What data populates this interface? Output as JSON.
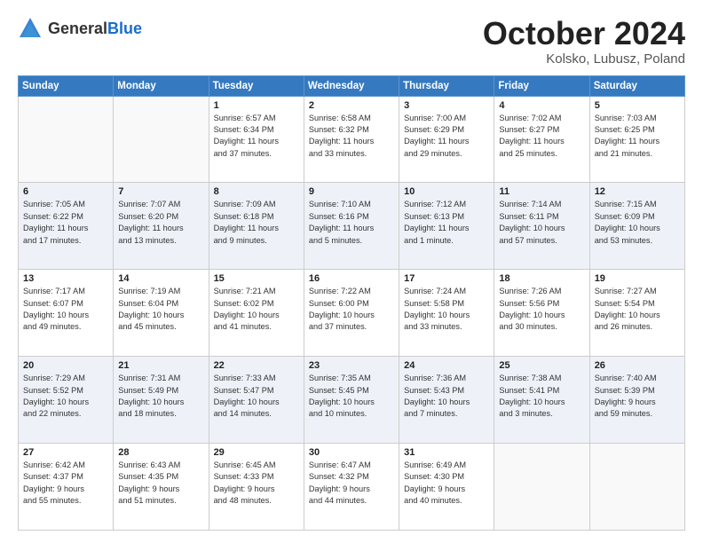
{
  "logo": {
    "general": "General",
    "blue": "Blue"
  },
  "header": {
    "month": "October 2024",
    "location": "Kolsko, Lubusz, Poland"
  },
  "weekdays": [
    "Sunday",
    "Monday",
    "Tuesday",
    "Wednesday",
    "Thursday",
    "Friday",
    "Saturday"
  ],
  "weeks": [
    [
      {
        "day": "",
        "info": ""
      },
      {
        "day": "",
        "info": ""
      },
      {
        "day": "1",
        "info": "Sunrise: 6:57 AM\nSunset: 6:34 PM\nDaylight: 11 hours\nand 37 minutes."
      },
      {
        "day": "2",
        "info": "Sunrise: 6:58 AM\nSunset: 6:32 PM\nDaylight: 11 hours\nand 33 minutes."
      },
      {
        "day": "3",
        "info": "Sunrise: 7:00 AM\nSunset: 6:29 PM\nDaylight: 11 hours\nand 29 minutes."
      },
      {
        "day": "4",
        "info": "Sunrise: 7:02 AM\nSunset: 6:27 PM\nDaylight: 11 hours\nand 25 minutes."
      },
      {
        "day": "5",
        "info": "Sunrise: 7:03 AM\nSunset: 6:25 PM\nDaylight: 11 hours\nand 21 minutes."
      }
    ],
    [
      {
        "day": "6",
        "info": "Sunrise: 7:05 AM\nSunset: 6:22 PM\nDaylight: 11 hours\nand 17 minutes."
      },
      {
        "day": "7",
        "info": "Sunrise: 7:07 AM\nSunset: 6:20 PM\nDaylight: 11 hours\nand 13 minutes."
      },
      {
        "day": "8",
        "info": "Sunrise: 7:09 AM\nSunset: 6:18 PM\nDaylight: 11 hours\nand 9 minutes."
      },
      {
        "day": "9",
        "info": "Sunrise: 7:10 AM\nSunset: 6:16 PM\nDaylight: 11 hours\nand 5 minutes."
      },
      {
        "day": "10",
        "info": "Sunrise: 7:12 AM\nSunset: 6:13 PM\nDaylight: 11 hours\nand 1 minute."
      },
      {
        "day": "11",
        "info": "Sunrise: 7:14 AM\nSunset: 6:11 PM\nDaylight: 10 hours\nand 57 minutes."
      },
      {
        "day": "12",
        "info": "Sunrise: 7:15 AM\nSunset: 6:09 PM\nDaylight: 10 hours\nand 53 minutes."
      }
    ],
    [
      {
        "day": "13",
        "info": "Sunrise: 7:17 AM\nSunset: 6:07 PM\nDaylight: 10 hours\nand 49 minutes."
      },
      {
        "day": "14",
        "info": "Sunrise: 7:19 AM\nSunset: 6:04 PM\nDaylight: 10 hours\nand 45 minutes."
      },
      {
        "day": "15",
        "info": "Sunrise: 7:21 AM\nSunset: 6:02 PM\nDaylight: 10 hours\nand 41 minutes."
      },
      {
        "day": "16",
        "info": "Sunrise: 7:22 AM\nSunset: 6:00 PM\nDaylight: 10 hours\nand 37 minutes."
      },
      {
        "day": "17",
        "info": "Sunrise: 7:24 AM\nSunset: 5:58 PM\nDaylight: 10 hours\nand 33 minutes."
      },
      {
        "day": "18",
        "info": "Sunrise: 7:26 AM\nSunset: 5:56 PM\nDaylight: 10 hours\nand 30 minutes."
      },
      {
        "day": "19",
        "info": "Sunrise: 7:27 AM\nSunset: 5:54 PM\nDaylight: 10 hours\nand 26 minutes."
      }
    ],
    [
      {
        "day": "20",
        "info": "Sunrise: 7:29 AM\nSunset: 5:52 PM\nDaylight: 10 hours\nand 22 minutes."
      },
      {
        "day": "21",
        "info": "Sunrise: 7:31 AM\nSunset: 5:49 PM\nDaylight: 10 hours\nand 18 minutes."
      },
      {
        "day": "22",
        "info": "Sunrise: 7:33 AM\nSunset: 5:47 PM\nDaylight: 10 hours\nand 14 minutes."
      },
      {
        "day": "23",
        "info": "Sunrise: 7:35 AM\nSunset: 5:45 PM\nDaylight: 10 hours\nand 10 minutes."
      },
      {
        "day": "24",
        "info": "Sunrise: 7:36 AM\nSunset: 5:43 PM\nDaylight: 10 hours\nand 7 minutes."
      },
      {
        "day": "25",
        "info": "Sunrise: 7:38 AM\nSunset: 5:41 PM\nDaylight: 10 hours\nand 3 minutes."
      },
      {
        "day": "26",
        "info": "Sunrise: 7:40 AM\nSunset: 5:39 PM\nDaylight: 9 hours\nand 59 minutes."
      }
    ],
    [
      {
        "day": "27",
        "info": "Sunrise: 6:42 AM\nSunset: 4:37 PM\nDaylight: 9 hours\nand 55 minutes."
      },
      {
        "day": "28",
        "info": "Sunrise: 6:43 AM\nSunset: 4:35 PM\nDaylight: 9 hours\nand 51 minutes."
      },
      {
        "day": "29",
        "info": "Sunrise: 6:45 AM\nSunset: 4:33 PM\nDaylight: 9 hours\nand 48 minutes."
      },
      {
        "day": "30",
        "info": "Sunrise: 6:47 AM\nSunset: 4:32 PM\nDaylight: 9 hours\nand 44 minutes."
      },
      {
        "day": "31",
        "info": "Sunrise: 6:49 AM\nSunset: 4:30 PM\nDaylight: 9 hours\nand 40 minutes."
      },
      {
        "day": "",
        "info": ""
      },
      {
        "day": "",
        "info": ""
      }
    ]
  ]
}
